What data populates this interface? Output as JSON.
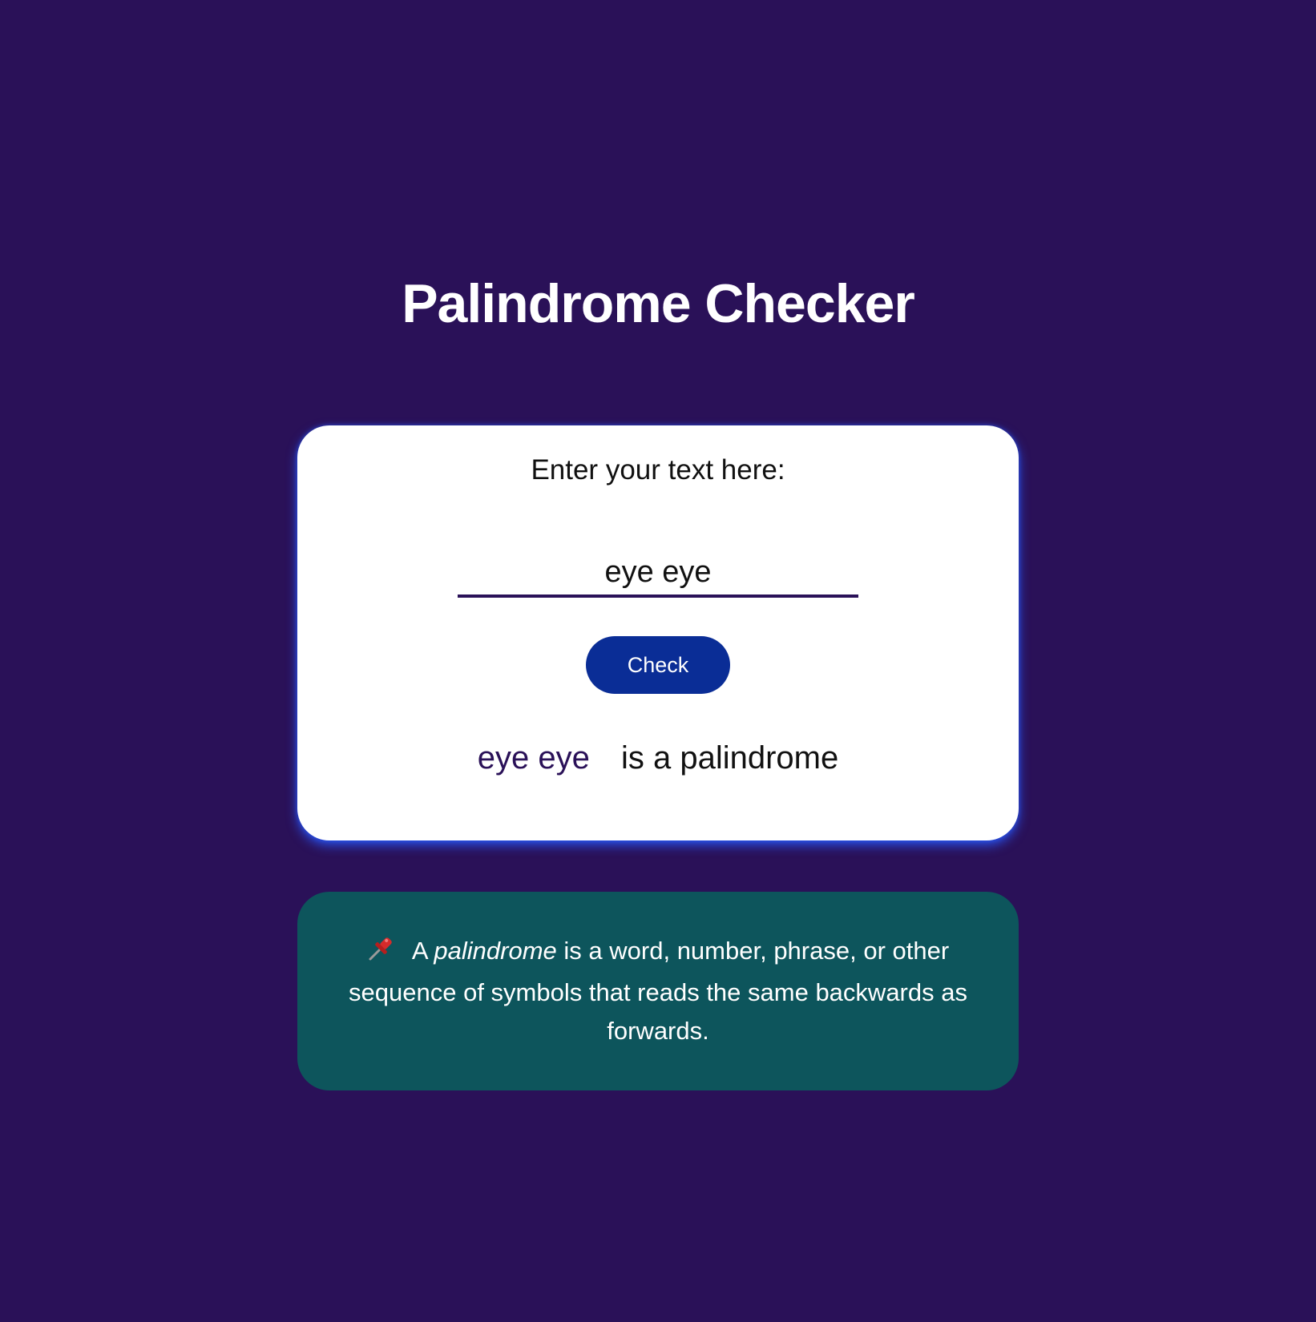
{
  "title": "Palindrome Checker",
  "form": {
    "label": "Enter your text here:",
    "input_value": "eye eye",
    "button_label": "Check"
  },
  "result": {
    "input_text": "eye eye",
    "message": "is a palindrome"
  },
  "info": {
    "icon": "pushpin-icon",
    "prefix": "A",
    "term": "palindrome",
    "rest": "is a word, number, phrase, or other sequence of symbols that reads the same backwards as forwards."
  },
  "colors": {
    "background": "#2a1158",
    "card": "#ffffff",
    "button": "#0a2d96",
    "info_card": "#0d555c",
    "glow": "#285aff"
  }
}
